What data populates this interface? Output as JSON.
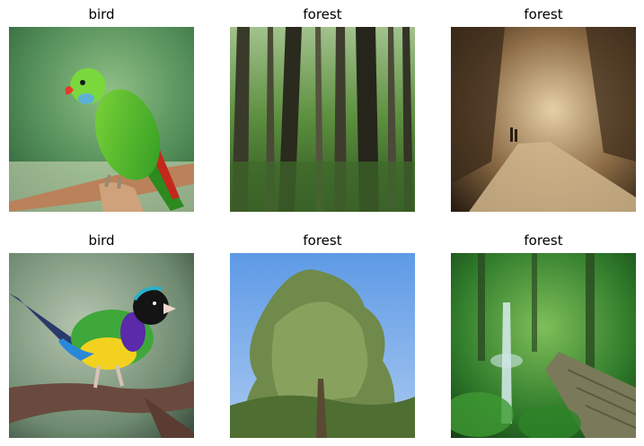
{
  "grid": {
    "items": [
      {
        "label": "bird",
        "icon": "green-parrot-photo"
      },
      {
        "label": "forest",
        "icon": "tall-tree-trunks-photo"
      },
      {
        "label": "forest",
        "icon": "sepia-forest-path-photo"
      },
      {
        "label": "bird",
        "icon": "gouldian-finch-photo"
      },
      {
        "label": "forest",
        "icon": "pine-tree-blue-sky-photo"
      },
      {
        "label": "forest",
        "icon": "waterfall-boardwalk-photo"
      }
    ]
  }
}
